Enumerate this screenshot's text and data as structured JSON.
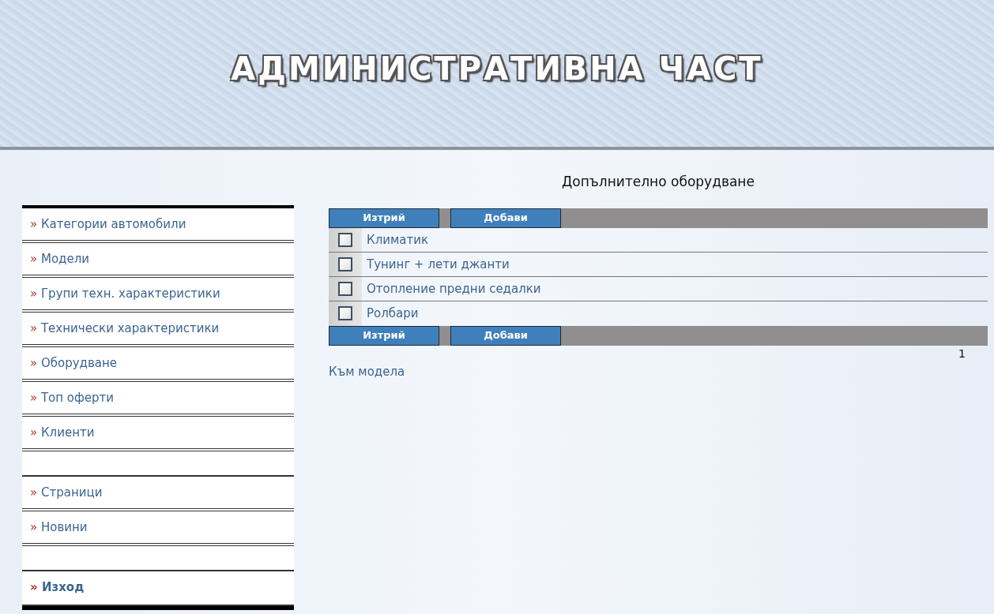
{
  "header": {
    "title": "АДМИНИСТРАТИВНА ЧАСТ"
  },
  "sidebar": {
    "items": [
      {
        "kind": "link",
        "marker": "»",
        "label": "Категории автомобили"
      },
      {
        "kind": "link",
        "marker": "»",
        "label": "Модели"
      },
      {
        "kind": "link",
        "marker": "»",
        "label": "Групи техн. характеристики"
      },
      {
        "kind": "link",
        "marker": "»",
        "label": "Технически характеристики"
      },
      {
        "kind": "link",
        "marker": "»",
        "label": "Оборудване"
      },
      {
        "kind": "link",
        "marker": "»",
        "label": "Топ оферти"
      },
      {
        "kind": "link",
        "marker": "»",
        "label": "Клиенти"
      },
      {
        "kind": "spacer"
      },
      {
        "kind": "link",
        "marker": "»",
        "label": "Страници"
      },
      {
        "kind": "link",
        "marker": "»",
        "label": "Новини"
      },
      {
        "kind": "spacer"
      },
      {
        "kind": "exit",
        "marker": "»",
        "label": "Изход"
      }
    ]
  },
  "main": {
    "heading": "Допълнително оборудване",
    "top_buttons": [
      "Изтрий",
      "Добави"
    ],
    "items": [
      {
        "label": "Климатик",
        "checked": false
      },
      {
        "label": "Тунинг + лети джанти",
        "checked": false
      },
      {
        "label": "Отопление предни седалки",
        "checked": false
      },
      {
        "label": "Ролбари",
        "checked": false
      }
    ],
    "bottom_buttons": [
      "Изтрий",
      "Добави"
    ],
    "pagination": "1",
    "back_link": "Към модела"
  }
}
